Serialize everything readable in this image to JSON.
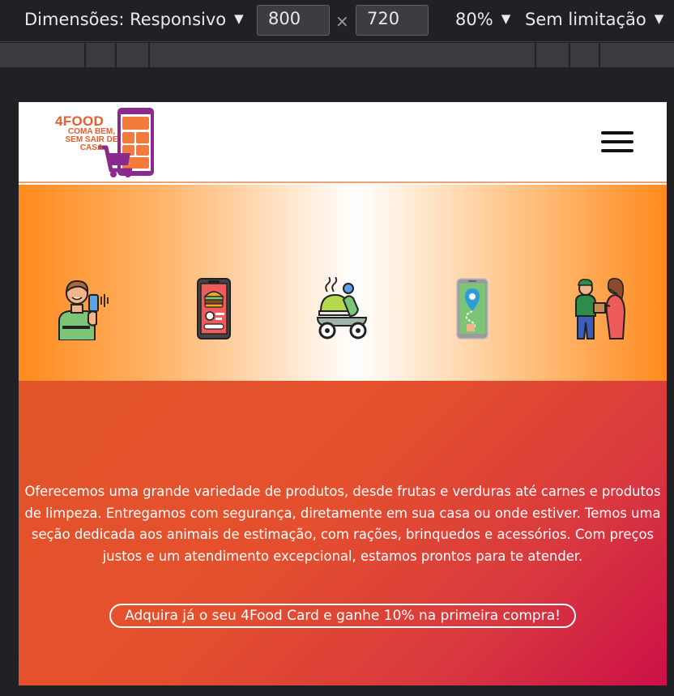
{
  "devtools": {
    "dimensions_label": "Dimensões: Responsivo",
    "width": "800",
    "height": "720",
    "times": "×",
    "zoom": "80%",
    "throttle": "Sem limitação"
  },
  "header": {
    "logo": {
      "title": "4FOOD",
      "tagline": [
        "COMA BEM,",
        "SEM SAIR DE",
        "CASA"
      ]
    }
  },
  "icons": [
    "person-with-phone-icon",
    "phone-order-app-icon",
    "delivery-scooter-icon",
    "location-map-phone-icon",
    "delivery-handoff-icon"
  ],
  "promo": {
    "text": "Oferecemos uma grande variedade de produtos, desde frutas e verduras até carnes e produtos de limpeza. Entregamos com segurança, diretamente em sua casa ou onde estiver. Temos uma seção dedicada aos animais de estimação, com rações, brinquedos e acessórios. Com preços justos e um atendimento excepcional, estamos prontos para te atender.",
    "cta_label": "Adquira já o seu 4Food Card e ganhe 10% na primeira compra!"
  },
  "colors": {
    "brand_orange": "#e85d2c",
    "brand_purple": "#8a2a8f",
    "band_orange": "#ff8a1e",
    "promo_red": "#e2542a",
    "promo_crimson": "#cc1048"
  }
}
